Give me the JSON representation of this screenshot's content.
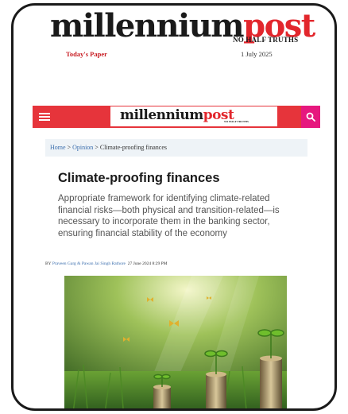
{
  "masthead": {
    "logo_main": "millennium",
    "logo_accent": "post",
    "tagline": "NO HALF TRUTHS",
    "todays_paper": "Today's Paper",
    "date": "1 July 2025"
  },
  "navbar": {
    "logo_main": "millennium",
    "logo_accent": "post",
    "logo_tagline": "NO HALF TRUTHS"
  },
  "breadcrumb": {
    "home": "Home",
    "sep1": " > ",
    "section": "Opinion",
    "sep2": " > ",
    "current": "Climate-proofing finances"
  },
  "article": {
    "title": "Climate-proofing finances",
    "standfirst": "Appropriate framework for identifying climate-related financial risks—both physical and transition-related—is necessary to incorporate them in the banking sector, ensuring financial stability of the economy",
    "byline_prefix": "BY ",
    "authors": "Praveen Garg & Pawan Jai Singh Rathore",
    "byline_date": "27 June 2024 8:29 PM"
  },
  "colors": {
    "brand_red": "#e6343b",
    "search_pink": "#e6187e",
    "link_blue": "#3c6fae"
  },
  "icons": {
    "menu": "hamburger-menu-icon",
    "search": "search-icon"
  }
}
